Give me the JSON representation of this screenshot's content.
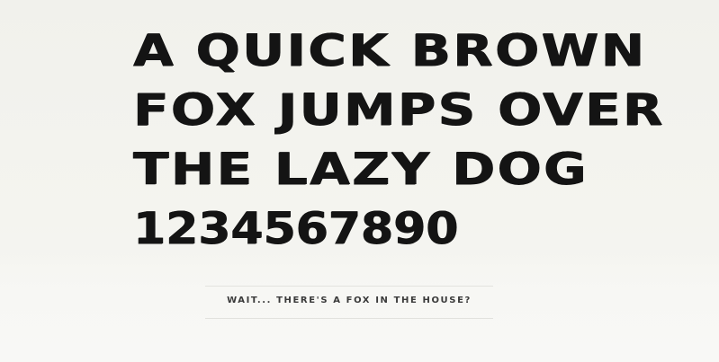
{
  "specimen": {
    "lines": [
      "A QUICK BROWN",
      "FOX JUMPS OVER",
      "THE LAZY DOG",
      "1234567890"
    ]
  },
  "tagline": {
    "text": "WAIT... THERE'S A FOX IN THE HOUSE?"
  },
  "colors": {
    "background": "#f3f3ee",
    "text": "#141414",
    "tagline": "#3a3a3a"
  }
}
